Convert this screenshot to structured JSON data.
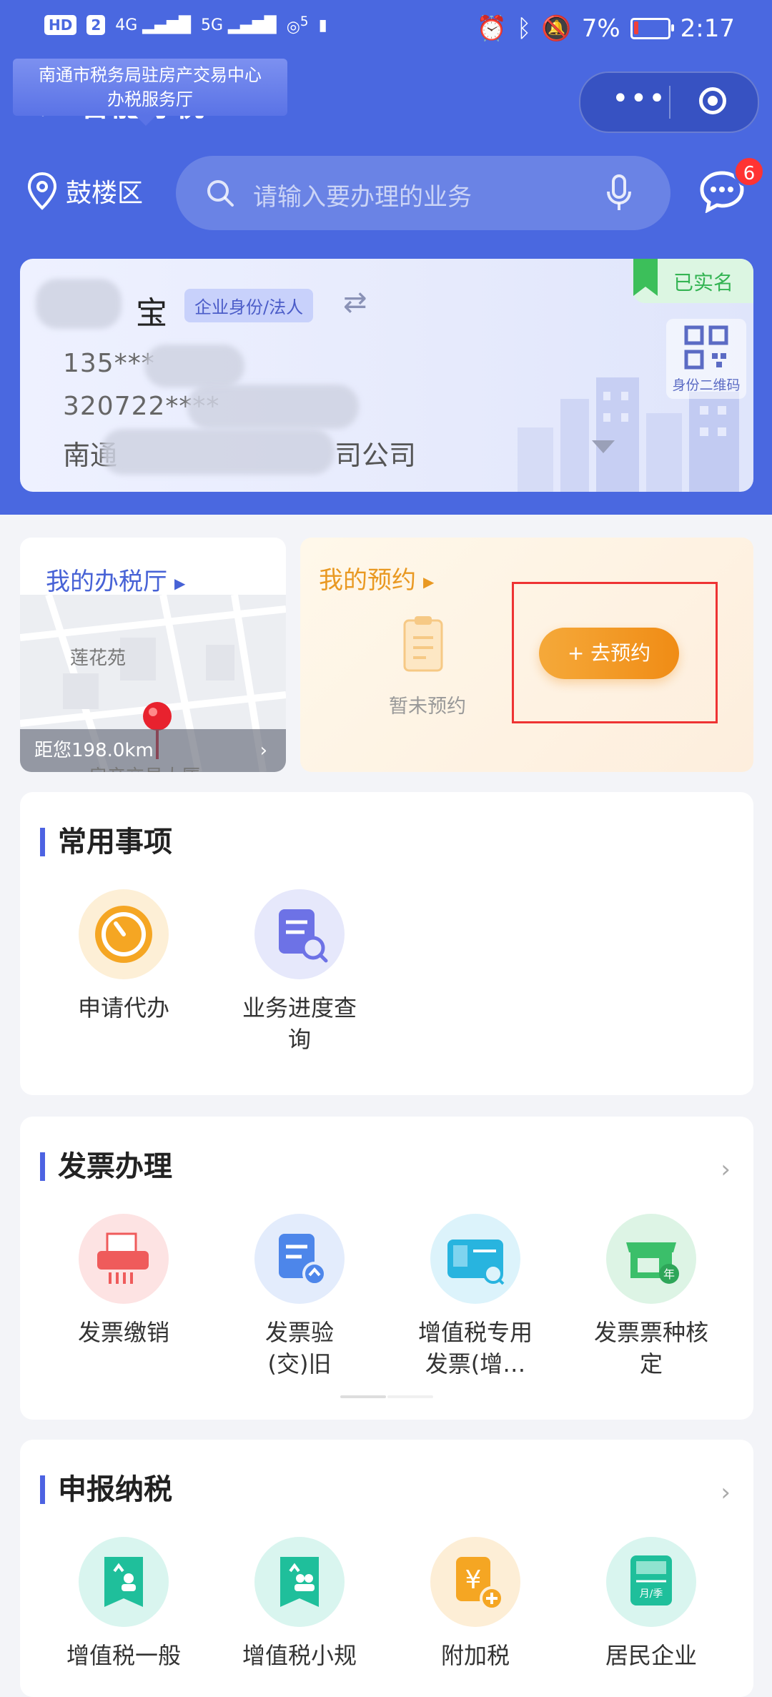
{
  "status_bar": {
    "hd": "HD",
    "sim": "2",
    "net1": "4G",
    "net2": "5G",
    "wifi_gen": "5",
    "battery_pct": "7%",
    "time": "2:17"
  },
  "nav": {
    "back_icon": "chevron-left-icon",
    "title": "智能导税",
    "more_icon": "more-dots-icon",
    "close_icon": "target-ring-icon"
  },
  "location": {
    "label": "鼓楼区",
    "icon": "location-pin-icon"
  },
  "search": {
    "placeholder": "请输入要办理的业务"
  },
  "messages": {
    "badge": "6"
  },
  "identity": {
    "name_char": "宝",
    "role_tag": "企业身份/法人",
    "phone_prefix": "135***",
    "id_prefix": "320722****",
    "company_prefix": "南通",
    "company_suffix": "司公司",
    "verified": "已实名",
    "qr_label": "身份二维码"
  },
  "tax_hall": {
    "title": "我的办税厅",
    "hall_name_line1": "南通市税务局驻房产交易中心",
    "hall_name_line2": "办税服务厅",
    "map_label_top": "莲花苑",
    "map_label_bottom": "房产交易大厦",
    "distance": "距您198.0km"
  },
  "appointment": {
    "title": "我的预约",
    "empty_text": "暂未预约",
    "button_label": "+ 去预约"
  },
  "common": {
    "title": "常用事项",
    "items": [
      {
        "label": "申请代办",
        "icon": "stopwatch-icon"
      },
      {
        "label": "业务进度查询",
        "icon": "document-search-icon"
      }
    ]
  },
  "invoice": {
    "title": "发票办理",
    "items": [
      {
        "label": "发票缴销",
        "icon": "shredder-icon"
      },
      {
        "label": "发票验(交)旧",
        "icon": "document-upload-icon"
      },
      {
        "label": "增值税专用发票(增…",
        "icon": "vat-card-icon"
      },
      {
        "label": "发票票种核定",
        "icon": "store-year-icon"
      }
    ]
  },
  "declare": {
    "title": "申报纳税",
    "items": [
      {
        "label": "增值税一般",
        "icon": "book-upload-person-icon"
      },
      {
        "label": "增值税小规",
        "icon": "book-upload-group-icon"
      },
      {
        "label": "附加税",
        "icon": "yuan-plus-icon"
      },
      {
        "label": "居民企业",
        "icon": "ledger-monthly-icon"
      }
    ]
  },
  "colors": {
    "primary": "#4a68e0",
    "accent_orange": "#f08c15",
    "verified_green": "#34b453",
    "highlight_red": "#e33333"
  }
}
